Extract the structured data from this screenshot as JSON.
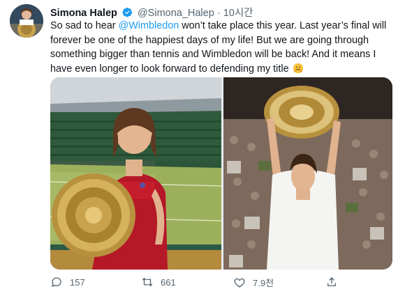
{
  "tweet": {
    "author_name": "Simona Halep",
    "handle": "@Simona_Halep",
    "separator": "·",
    "time": "10시간",
    "text_before": "So sad to hear ",
    "mention": "@Wimbledon",
    "text_after": " won’t take place this year. Last year’s final will forever be one of the happiest days of my life! But we are going through something bigger than tennis and Wimbledon will be back! And it means I have even longer to look forward to defending my title",
    "emoji": "hugging-face-emoji"
  },
  "actions": {
    "replies": "157",
    "retweets": "661",
    "likes": "7.9천"
  },
  "icons": {
    "verified": "verified-badge-icon",
    "reply": "reply-icon",
    "retweet": "retweet-icon",
    "like": "heart-icon",
    "share": "share-icon"
  },
  "colors": {
    "accent": "#1d9bf0",
    "muted": "#536471",
    "text": "#0f1419"
  }
}
